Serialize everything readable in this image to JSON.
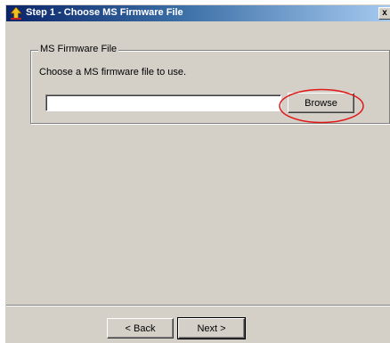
{
  "window": {
    "title": "Step 1 - Choose MS Firmware File",
    "close_glyph": "x"
  },
  "group": {
    "legend": "MS Firmware File",
    "description": "Choose a MS firmware file to use.",
    "file_path_value": "",
    "browse_label": "Browse"
  },
  "nav": {
    "back_label": "< Back",
    "next_label": "Next >"
  },
  "colors": {
    "dialog_bg": "#d4d0c8",
    "titlebar_start": "#0a246a",
    "titlebar_end": "#a6caf0",
    "highlight_circle": "#e01818"
  },
  "icons": {
    "title": "wizard-upload-icon"
  }
}
